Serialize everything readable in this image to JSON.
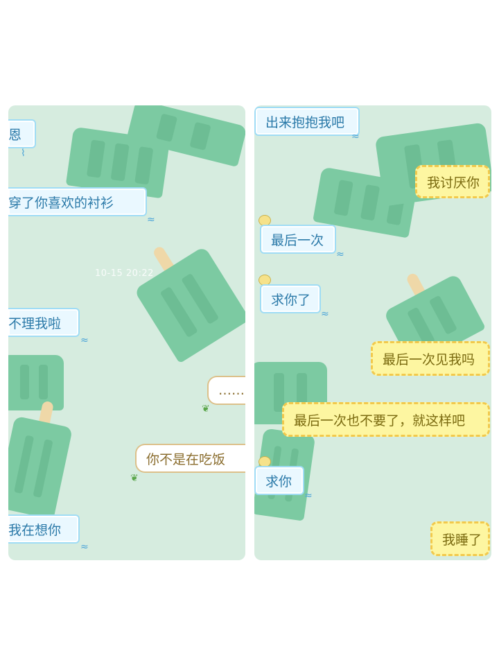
{
  "left_panel": {
    "timestamp": "10-15 20:22",
    "messages": [
      {
        "side": "received",
        "text": "恩"
      },
      {
        "side": "received",
        "text": "穿了你喜欢的衬衫"
      },
      {
        "side": "received",
        "text": "不理我啦"
      },
      {
        "side": "sent",
        "text": "……"
      },
      {
        "side": "sent",
        "text": "你不是在吃饭"
      },
      {
        "side": "received",
        "text": "我在想你"
      }
    ]
  },
  "right_panel": {
    "messages": [
      {
        "side": "received",
        "text": "出来抱抱我吧"
      },
      {
        "side": "sent",
        "text": "我讨厌你"
      },
      {
        "side": "received",
        "text": "最后一次"
      },
      {
        "side": "received",
        "text": "求你了"
      },
      {
        "side": "sent",
        "text": "最后一次见我吗"
      },
      {
        "side": "sent",
        "text": "最后一次也不要了，就这样吧"
      },
      {
        "side": "received",
        "text": "求你"
      },
      {
        "side": "sent",
        "text": "我睡了"
      }
    ]
  },
  "colors": {
    "background": "#d6ecdf",
    "popsicle": "#7ccaa2",
    "received_text": "#2a79a8",
    "sent_yellow_bg": "#fdf6a1"
  },
  "icons": [
    "wave-icon",
    "leaf-icon",
    "sticker-icon"
  ]
}
